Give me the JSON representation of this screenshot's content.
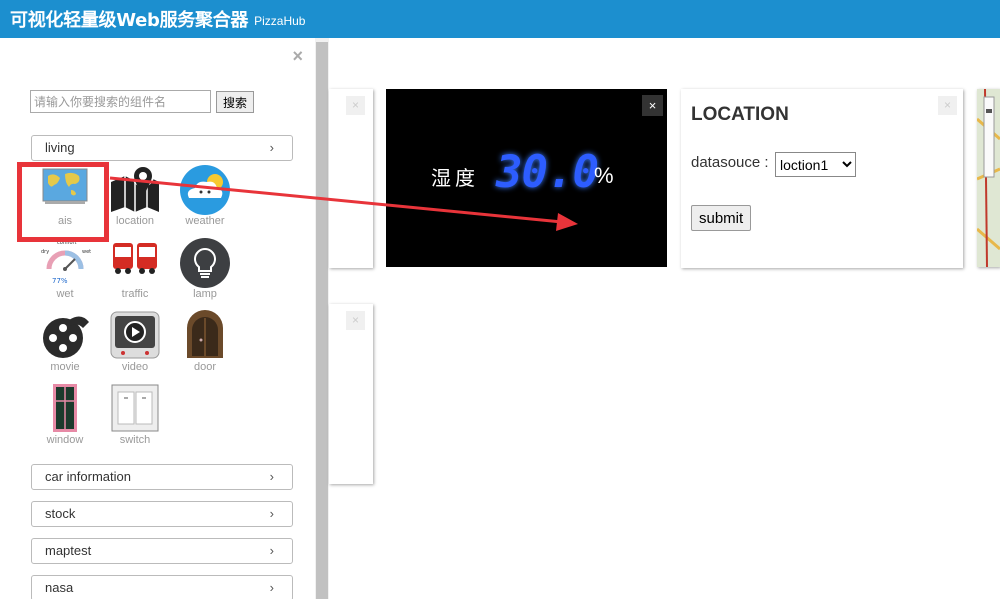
{
  "header": {
    "title": "可视化轻量级Web服务聚合器",
    "subtitle": "PizzaHub"
  },
  "sidebar": {
    "close": "×",
    "search": {
      "placeholder": "请输入你要搜索的组件名",
      "button": "搜索"
    },
    "categories": [
      {
        "label": "living",
        "chevron": "›"
      },
      {
        "label": "car information",
        "chevron": "›"
      },
      {
        "label": "stock",
        "chevron": "›"
      },
      {
        "label": "maptest",
        "chevron": "›"
      },
      {
        "label": "nasa",
        "chevron": "›"
      }
    ],
    "widgets": [
      {
        "label": "ais",
        "icon": "world-map-icon"
      },
      {
        "label": "location",
        "icon": "map-pin-icon"
      },
      {
        "label": "weather",
        "icon": "weather-icon"
      },
      {
        "label": "wet",
        "icon": "gauge-icon",
        "gauge": {
          "dry": "dry",
          "comfort": "comfort",
          "wet": "wet",
          "value": "77%"
        }
      },
      {
        "label": "traffic",
        "icon": "bus-icon"
      },
      {
        "label": "lamp",
        "icon": "lightbulb-icon"
      },
      {
        "label": "movie",
        "icon": "film-reel-icon"
      },
      {
        "label": "video",
        "icon": "video-player-icon"
      },
      {
        "label": "door",
        "icon": "door-icon"
      },
      {
        "label": "window",
        "icon": "window-icon"
      },
      {
        "label": "switch",
        "icon": "light-switch-icon"
      }
    ]
  },
  "main": {
    "humidity": {
      "label": "湿度",
      "value": "30.0",
      "unit": "%",
      "close": "×"
    },
    "location": {
      "title": "LOCATION",
      "datasource_label": "datasouce :",
      "selected": "loction1",
      "submit": "submit"
    },
    "card_close": "×"
  },
  "colors": {
    "header": "#1c8fcf",
    "highlight": "#e8343a",
    "humidity_digits": "#2d5dff"
  }
}
